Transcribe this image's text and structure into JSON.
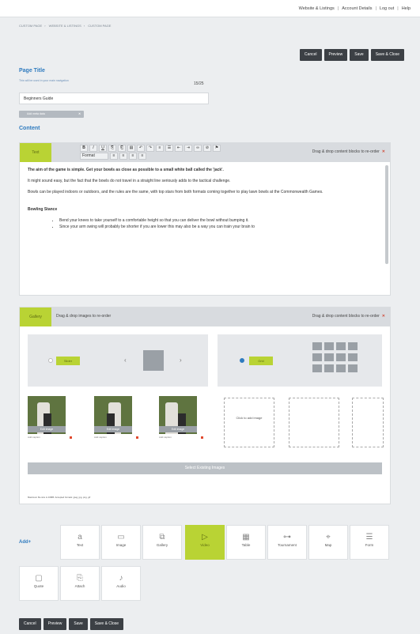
{
  "top_links": [
    "Website & Listings",
    "Account Details",
    "Log out",
    "Help"
  ],
  "breadcrumb": [
    "CUSTOM PAGE",
    "WEBSITE & LISTINGS",
    "CUSTOM PAGE"
  ],
  "actions": {
    "cancel": "Cancel",
    "preview": "Preview",
    "save": "Save",
    "save_close": "Save & Close"
  },
  "page_title": {
    "heading": "Page Title",
    "hint": "This will be used in your main navigation",
    "counter": "15/25",
    "value": "Beginners Guide",
    "chip": "Add meta data"
  },
  "content": {
    "heading": "Content",
    "text_block": {
      "tag": "Text",
      "drag_note": "Drag & drop content blocks to re-order",
      "format_select": "Format",
      "heading_line": "The aim of the game is simple. Get your bowls as close as possible to a small white ball called the 'jack'.",
      "p1": "It might sound easy, but the fact that the bowls do not travel in a straight line seriously adds to the tactical challenge.",
      "p2": "Bowls can be played indoors or outdoors, and the rules are the same, with top stars from both formats coming together to play lawn bowls at the Commonwealth Games.",
      "stance_heading": "Bowling Stance",
      "bullets": [
        "Bend your knees to take yourself to a comfortable height so that you can deliver the bowl without bumping it.",
        "Since your arm swing will probably be shorter if you are lower this may also be a way you can train your brain to"
      ]
    },
    "gallery_block": {
      "tag": "Gallery",
      "subtitle": "Drag & drop images to re-order",
      "drag_note": "Drag & drop content blocks to re-order",
      "slider_label": "Slider",
      "grid_label": "Grid",
      "edit_label": "Edit image",
      "caption_label": "Add caption",
      "drop_text": "Click to add image",
      "select_existing": "Select Existing Images",
      "max_note": "Maximum file size is 10MB. Accepted formats: jpeg, jpg, png, gif"
    }
  },
  "add_blocks": {
    "label": "Add+",
    "items": [
      {
        "label": "Text",
        "icon": "a"
      },
      {
        "label": "Image",
        "icon": "▭"
      },
      {
        "label": "Gallery",
        "icon": "⧉"
      },
      {
        "label": "Video",
        "icon": "▷"
      },
      {
        "label": "Table",
        "icon": "▦"
      },
      {
        "label": "Tournament",
        "icon": "⊶"
      },
      {
        "label": "Map",
        "icon": "⌖"
      },
      {
        "label": "Form",
        "icon": "☰"
      },
      {
        "label": "Quote",
        "icon": "▢"
      },
      {
        "label": "Attach",
        "icon": "⎘"
      },
      {
        "label": "Audio",
        "icon": "♪"
      }
    ]
  },
  "colors": {
    "accent": "#b9d334",
    "heading": "#2f7bbf",
    "button": "#3c4045"
  }
}
